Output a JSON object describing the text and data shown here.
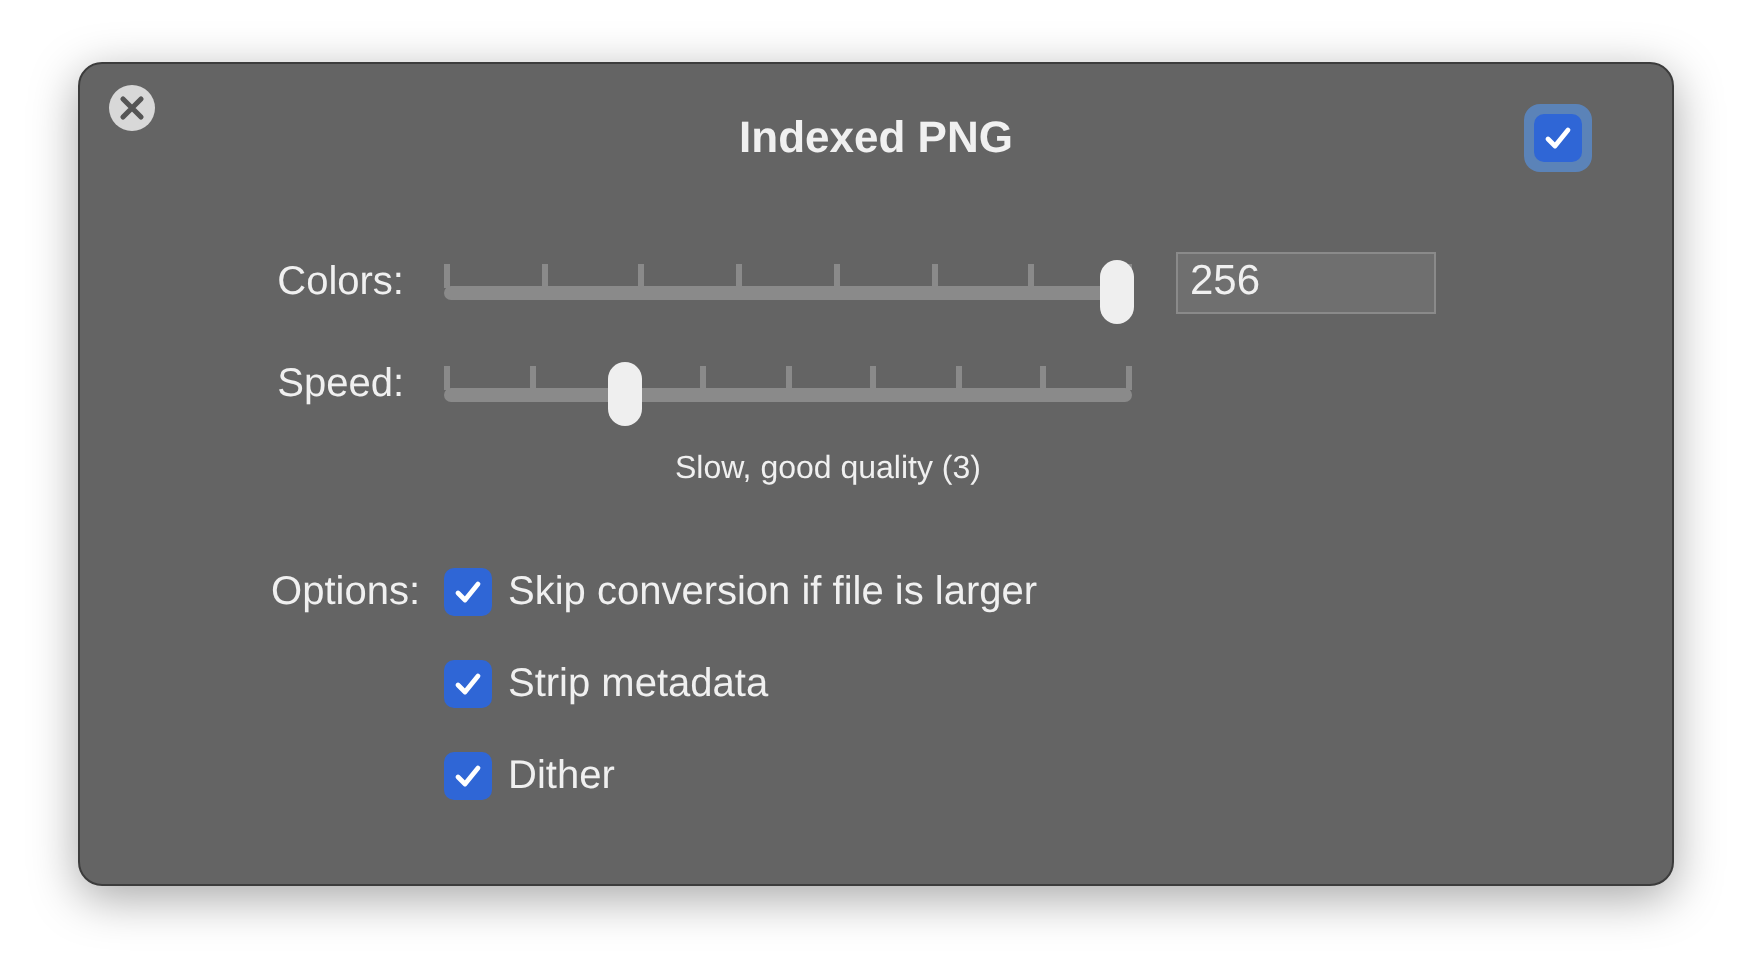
{
  "window": {
    "title": "Indexed PNG",
    "enabled": true
  },
  "sliders": [
    {
      "label": "Colors:",
      "level": 1,
      "value": "256"
    },
    {
      "label": "Speed:",
      "level": 0.25,
      "caption": "Slow, good quality (3)"
    }
  ],
  "options": {
    "label": "Options:",
    "items": [
      {
        "label": "Skip conversion if file is larger",
        "checked": true
      },
      {
        "label": "Strip metadata",
        "checked": true
      },
      {
        "label": "Dither",
        "checked": true
      }
    ]
  }
}
